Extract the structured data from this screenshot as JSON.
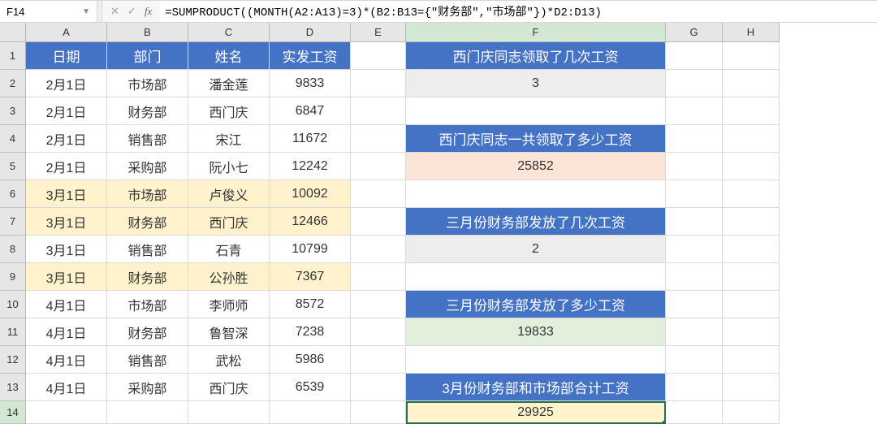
{
  "nameBox": "F14",
  "formula": "=SUMPRODUCT((MONTH(A2:A13)=3)*(B2:B13={\"财务部\",\"市场部\"})*D2:D13)",
  "columns": [
    "A",
    "B",
    "C",
    "D",
    "E",
    "F",
    "G",
    "H"
  ],
  "rowNums": [
    "1",
    "2",
    "3",
    "4",
    "5",
    "6",
    "7",
    "8",
    "9",
    "10",
    "11",
    "12",
    "13",
    "14"
  ],
  "headers": {
    "A": "日期",
    "B": "部门",
    "C": "姓名",
    "D": "实发工资"
  },
  "rows": [
    {
      "A": "2月1日",
      "B": "市场部",
      "C": "潘金莲",
      "D": "9833",
      "hl": false
    },
    {
      "A": "2月1日",
      "B": "财务部",
      "C": "西门庆",
      "D": "6847",
      "hl": false
    },
    {
      "A": "2月1日",
      "B": "销售部",
      "C": "宋江",
      "D": "11672",
      "hl": false
    },
    {
      "A": "2月1日",
      "B": "采购部",
      "C": "阮小七",
      "D": "12242",
      "hl": false
    },
    {
      "A": "3月1日",
      "B": "市场部",
      "C": "卢俊义",
      "D": "10092",
      "hl": true
    },
    {
      "A": "3月1日",
      "B": "财务部",
      "C": "西门庆",
      "D": "12466",
      "hl": true
    },
    {
      "A": "3月1日",
      "B": "销售部",
      "C": "石青",
      "D": "10799",
      "hl": false
    },
    {
      "A": "3月1日",
      "B": "财务部",
      "C": "公孙胜",
      "D": "7367",
      "hl": true
    },
    {
      "A": "4月1日",
      "B": "市场部",
      "C": "李师师",
      "D": "8572",
      "hl": false
    },
    {
      "A": "4月1日",
      "B": "财务部",
      "C": "鲁智深",
      "D": "7238",
      "hl": false
    },
    {
      "A": "4月1日",
      "B": "销售部",
      "C": "武松",
      "D": "5986",
      "hl": false
    },
    {
      "A": "4月1日",
      "B": "采购部",
      "C": "西门庆",
      "D": "6539",
      "hl": false
    }
  ],
  "F": {
    "q1": "西门庆同志领取了几次工资",
    "a1": "3",
    "q2": "西门庆同志一共领取了多少工资",
    "a2": "25852",
    "q3": "三月份财务部发放了几次工资",
    "a3": "2",
    "q4": "三月份财务部发放了多少工资",
    "a4": "19833",
    "q5": "3月份财务部和市场部合计工资",
    "a5": "29925"
  }
}
